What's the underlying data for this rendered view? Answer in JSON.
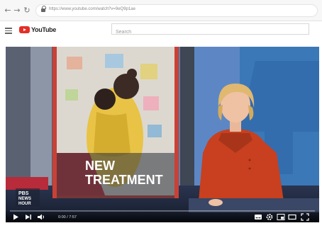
{
  "browser": {
    "back_icon": "arrow-left-icon",
    "forward_icon": "arrow-right-icon",
    "reload_icon": "reload-icon",
    "url": "https://www.youtube.com/watch?v=9eQ9p1ae"
  },
  "youtube": {
    "logo_text": "YouTube",
    "search_placeholder": "Search"
  },
  "video": {
    "overlay_line1": "NEW",
    "overlay_line2": "TREATMENT",
    "channel_bug_line1": "PBS",
    "channel_bug_line2": "NEWS",
    "channel_bug_line3": "HOUR",
    "time_display": "0:00 / 7:57",
    "progress": 0.0
  },
  "colors": {
    "brand_red": "#e52d27",
    "anchor_jacket": "#c8401f",
    "studio_blue": "#3a78b8"
  }
}
